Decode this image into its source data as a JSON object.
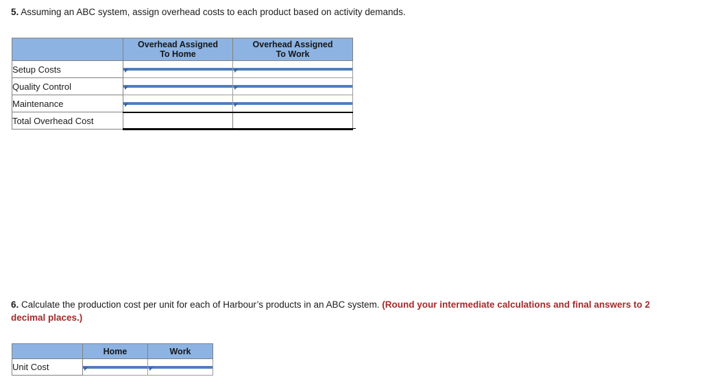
{
  "questions": [
    {
      "number": "5.",
      "text": " Assuming an ABC system, assign overhead costs to each product based on activity demands.",
      "note": ""
    },
    {
      "number": "6.",
      "text": " Calculate the production cost per unit for each of Harbour’s products in an ABC system. ",
      "note": "(Round your intermediate calculations and final answers to 2 decimal places.)"
    }
  ],
  "overhead_table": {
    "headers": {
      "corner": "",
      "home": "Overhead Assigned To Home",
      "home_line1": "Overhead Assigned",
      "home_line2": "To Home",
      "work": "Overhead Assigned To Work",
      "work_line1": "Overhead Assigned",
      "work_line2": "To Work"
    },
    "rows": [
      {
        "label": "Setup Costs",
        "home": "",
        "work": "",
        "type": "input"
      },
      {
        "label": "Quality Control",
        "home": "",
        "work": "",
        "type": "input"
      },
      {
        "label": "Maintenance",
        "home": "",
        "work": "",
        "type": "input"
      },
      {
        "label": "Total Overhead Cost",
        "home": "",
        "work": "",
        "type": "total"
      }
    ]
  },
  "unitcost_table": {
    "headers": {
      "corner": "",
      "home": "Home",
      "work": "Work"
    },
    "rows": [
      {
        "label": "Unit Cost",
        "home": "",
        "work": "",
        "type": "input"
      }
    ]
  },
  "colors": {
    "header_blue": "#8db3e2",
    "input_border_blue": "#4d7ebf",
    "marker_blue": "#2f5f9e",
    "note_red": "#a32a2a",
    "grid_gray": "#7f7f7f",
    "text": "#1b1b1b"
  }
}
